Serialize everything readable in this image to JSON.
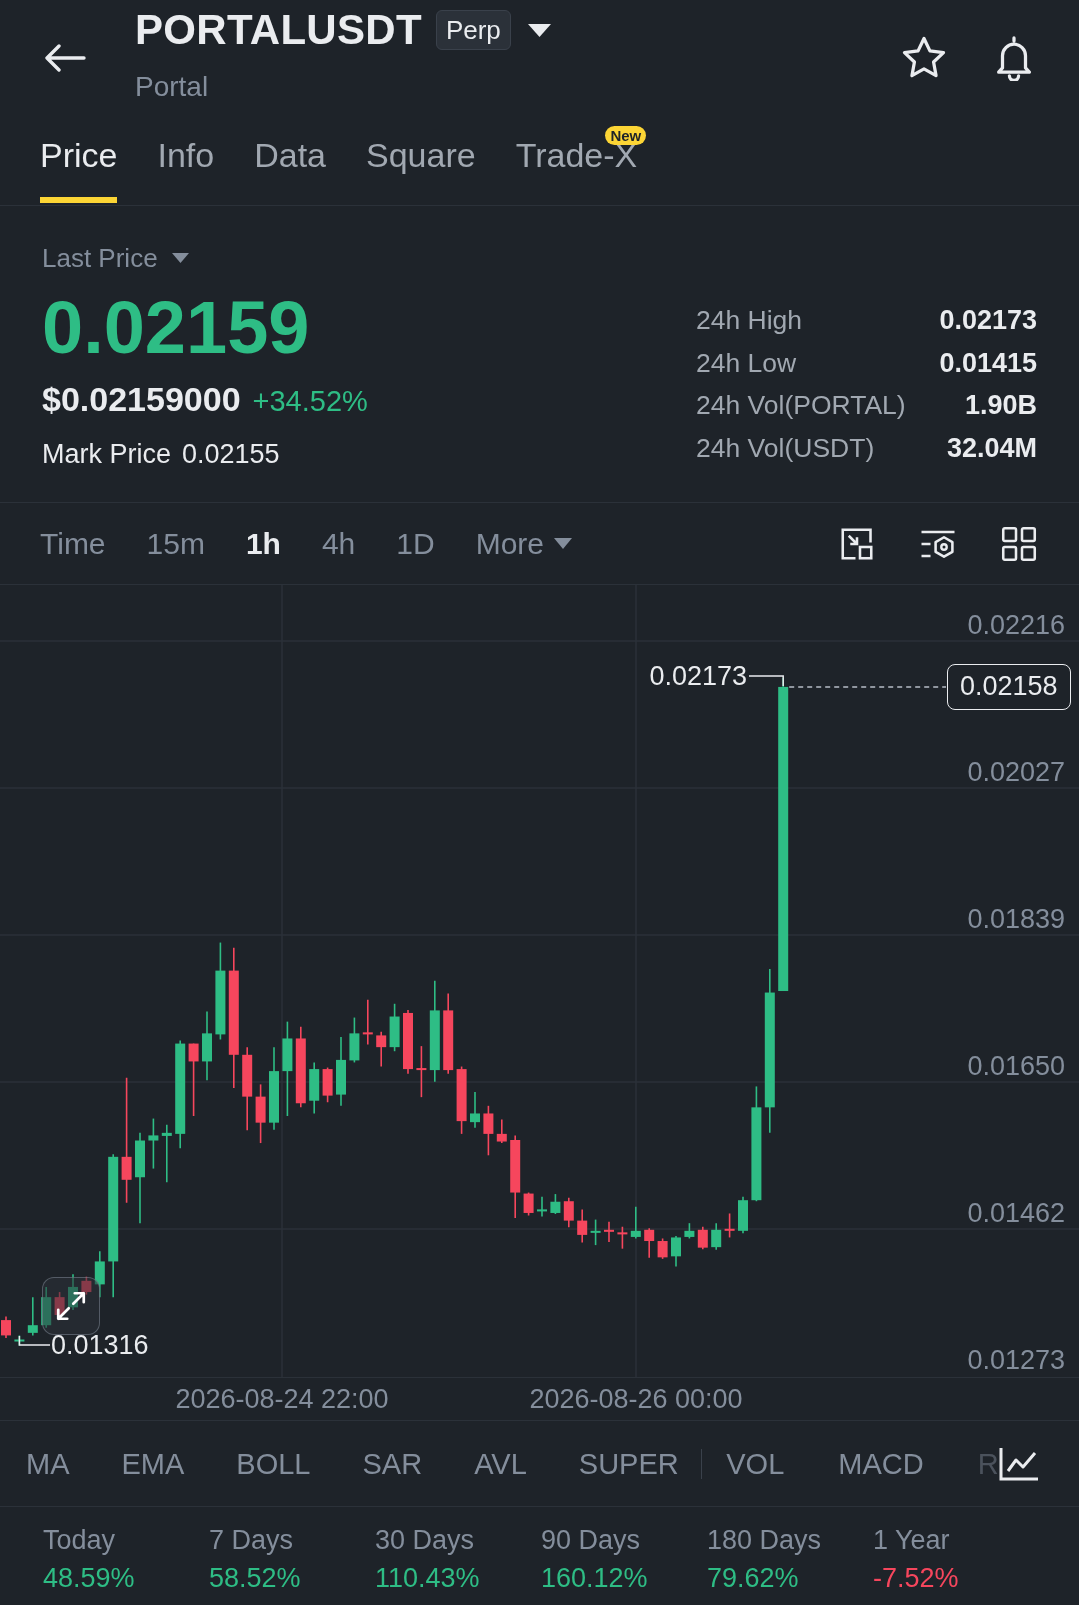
{
  "header": {
    "symbol": "PORTALUSDT",
    "contract_type": "Perp",
    "name": "Portal"
  },
  "tabs": [
    {
      "label": "Price",
      "selected": true
    },
    {
      "label": "Info",
      "selected": false
    },
    {
      "label": "Data",
      "selected": false
    },
    {
      "label": "Square",
      "selected": false
    },
    {
      "label": "Trade-X",
      "selected": false,
      "badge": "New"
    }
  ],
  "price_panel": {
    "price_type": "Last Price",
    "last_price": "0.02159",
    "usd_price": "$0.02159000",
    "change": "+34.52%",
    "negative": false,
    "mark_price_label": "Mark Price",
    "mark_price": "0.02155",
    "stats": [
      {
        "label": "24h High",
        "value": "0.02173"
      },
      {
        "label": "24h Low",
        "value": "0.01415"
      },
      {
        "label": "24h Vol(PORTAL)",
        "value": "1.90B"
      },
      {
        "label": "24h Vol(USDT)",
        "value": "32.04M"
      }
    ]
  },
  "intervals": [
    {
      "label": "Time",
      "kind": "option",
      "selected": false
    },
    {
      "label": "15m",
      "kind": "option",
      "selected": false
    },
    {
      "label": "1h",
      "kind": "option",
      "selected": true
    },
    {
      "label": "4h",
      "kind": "option",
      "selected": false
    },
    {
      "label": "1D",
      "kind": "option",
      "selected": false
    },
    {
      "label": "More",
      "kind": "menu",
      "selected": false
    }
  ],
  "chart": {
    "price_axis": [
      "0.02216",
      "0.02027",
      "0.01839",
      "0.01650",
      "0.01462",
      "0.01273"
    ],
    "high_label": "0.02173",
    "low_label": "0.01316",
    "current_price": "0.02158",
    "time_axis": [
      "2026-08-24 22:00",
      "2026-08-26 00:00"
    ]
  },
  "indicators": {
    "main": [
      "MA",
      "EMA",
      "BOLL",
      "SAR",
      "AVL",
      "SUPER"
    ],
    "sub": [
      "VOL",
      "MACD",
      "R"
    ]
  },
  "performance": [
    {
      "period": "Today",
      "change": "48.59%",
      "negative": false
    },
    {
      "period": "7 Days",
      "change": "58.52%",
      "negative": false
    },
    {
      "period": "30 Days",
      "change": "110.43%",
      "negative": false
    },
    {
      "period": "90 Days",
      "change": "160.12%",
      "negative": false
    },
    {
      "period": "180 Days",
      "change": "79.62%",
      "negative": false
    },
    {
      "period": "1 Year",
      "change": "-7.52%",
      "negative": true
    }
  ]
}
